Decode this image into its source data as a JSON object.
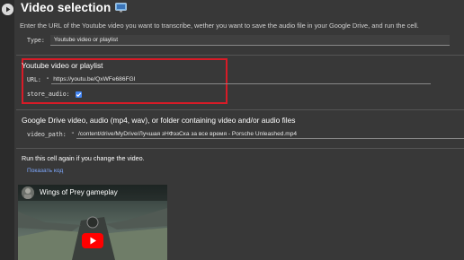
{
  "run_button": {
    "icon": "play-circle-icon"
  },
  "header": {
    "title": "Video selection",
    "icon": "monitor-screen-icon"
  },
  "description": "Enter the URL of the Youtube video you want to transcribe, wether you want to save the audio file in your Google Drive, and run the cell.",
  "type_param": {
    "label": "Type:",
    "value": "Youtube video or playlist"
  },
  "youtube_section": {
    "title": "Youtube video or playlist",
    "url_label": "URL:",
    "url_quote": "\"",
    "url_value": "https://youtu.be/QxWFe686FGI",
    "store_audio_label": "store_audio:",
    "store_audio_checked": true
  },
  "drive_section": {
    "title": "Google Drive video, audio (mp4, wav), or folder containing video and/or audio files",
    "video_path_label": "video_path:",
    "video_path_quote": "\"",
    "video_path_value": "/content/drive/MyDrive/Лучшая зНФэзСка за все время - Porsche Unleashed.mp4"
  },
  "rerun_note": "Run this cell again if you change the video.",
  "show_code_link": "Показать код",
  "video_preview": {
    "title": "Wings of Prey gameplay",
    "play_color": "#ff0000"
  },
  "colors": {
    "background": "#383838",
    "highlight_border": "#d81b27",
    "link": "#7fa9ff",
    "checkbox": "#4285f4"
  }
}
